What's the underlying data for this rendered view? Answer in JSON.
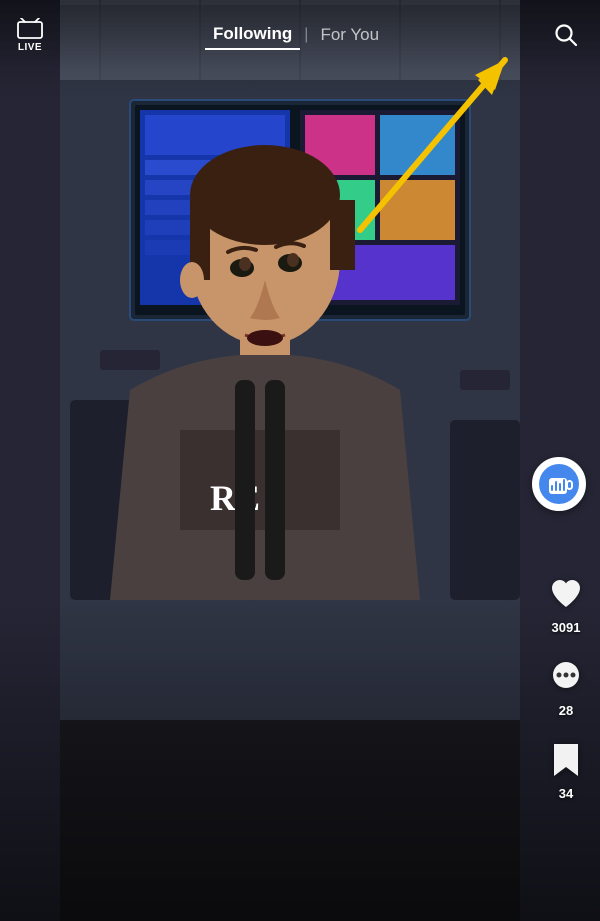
{
  "nav": {
    "live_label": "LIVE",
    "following_label": "Following",
    "for_you_label": "For You",
    "active_tab": "following",
    "separator": "|"
  },
  "actions": {
    "like_count": "3091",
    "comment_count": "28",
    "bookmark_count": "34"
  },
  "arrow": {
    "color": "#F5C200"
  },
  "icons": {
    "search": "search-icon",
    "heart": "heart-icon",
    "comment": "comment-icon",
    "bookmark": "bookmark-icon",
    "live_tv": "live-tv-icon",
    "profile": "profile-icon"
  }
}
